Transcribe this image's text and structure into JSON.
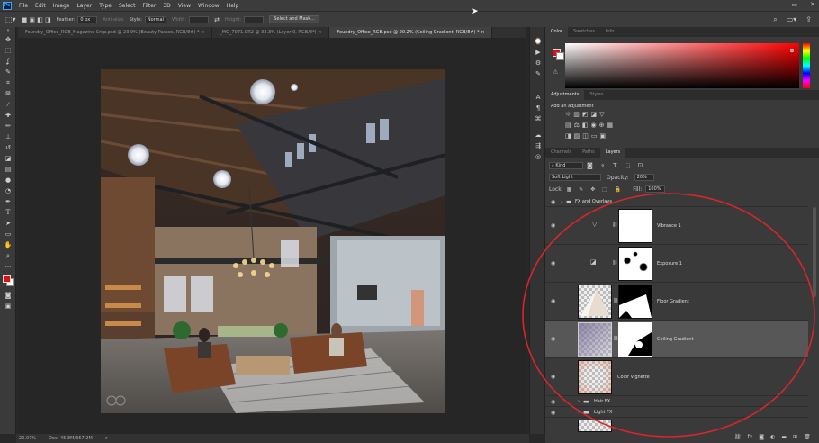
{
  "menubar": {
    "logo": "Ps",
    "items": [
      "File",
      "Edit",
      "Image",
      "Layer",
      "Type",
      "Select",
      "Filter",
      "3D",
      "View",
      "Window",
      "Help"
    ]
  },
  "options": {
    "feather_label": "Feather:",
    "feather_value": "0 px",
    "antialias_label": "Anti-alias",
    "style_label": "Style:",
    "style_value": "Normal",
    "width_label": "Width:",
    "height_label": "Height:",
    "select_mask_label": "Select and Mask..."
  },
  "tabs": [
    {
      "label": "Foundry_Office_RGB_Magazine Crop.psd @ 23.9% (Beauty Passes, RGB/8#) *",
      "close": "×"
    },
    {
      "label": "_MG_7071.CR2 @ 33.3% (Layer 0, RGB/8*)",
      "close": "×"
    },
    {
      "label": "Foundry_Office_RGB.psd @ 20.2% (Ceiling Gradient, RGB/8#) *",
      "close": "×"
    }
  ],
  "status": {
    "zoom": "20.07%",
    "doc": "Doc: 45.8M/357.2M",
    "arrow": ">"
  },
  "color_panel": {
    "tabs": [
      "Color",
      "Swatches",
      "Info"
    ],
    "fg": "#e01010",
    "bg": "#ffffff"
  },
  "adjustments": {
    "tabs": [
      "Adjustments",
      "Styles"
    ],
    "add_label": "Add an adjustment"
  },
  "layers_panel": {
    "tabs": [
      "Channels",
      "Paths",
      "Layers"
    ],
    "kind_label": "Kind",
    "blend_mode": "Soft Light",
    "opacity_label": "Opacity:",
    "opacity_value": "20%",
    "lock_label": "Lock:",
    "fill_label": "Fill:",
    "fill_value": "100%",
    "layers": [
      {
        "name": "FX and Overlays"
      },
      {
        "name": "Vibrance 1"
      },
      {
        "name": "Exposure 1"
      },
      {
        "name": "Floor Gradient"
      },
      {
        "name": "Ceiling Gradient"
      },
      {
        "name": "Color Vignette"
      },
      {
        "name": "Hair FX"
      },
      {
        "name": "Light FX"
      }
    ]
  },
  "colors": {
    "accent": "#31a8ff",
    "annotation": "#d8262a"
  }
}
